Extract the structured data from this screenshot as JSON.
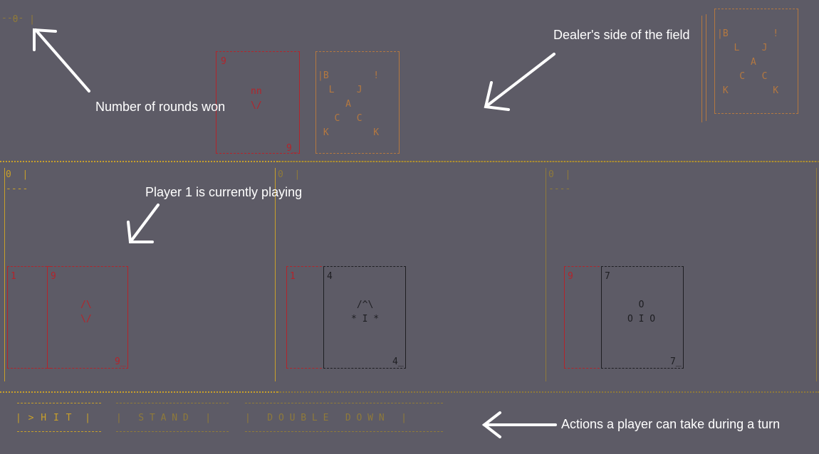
{
  "dealer": {
    "rounds_won": "0",
    "card_face_rank": "9",
    "card_face_pip": "nn\n\\/",
    "card_back_lines": "|B        !\n  L    J\n     A\n   C   C\n K        K",
    "deck_lines": "|B        !\n   L    J\n      A\n    C   C\n K        K"
  },
  "players": [
    {
      "rounds_won": "0",
      "card1_rank": "1",
      "card2_rank": "9",
      "card2_pip": "/\\\n\\/",
      "card2_corner": "9_",
      "active": true
    },
    {
      "rounds_won": "0",
      "card1_rank": "1",
      "card2_rank": "4",
      "card2_pip": " /^\\\n* I *",
      "card2_corner": "4_",
      "active": false
    },
    {
      "rounds_won": "0",
      "card1_rank": "9",
      "card2_rank": "7",
      "card2_pip": "  O\nO I O",
      "card2_corner": "7_",
      "active": false
    }
  ],
  "actions": {
    "hit": "| > H I T  |",
    "stand": "|   S T A N D   |",
    "double_down": "|   D O U B L E   D O W N   |"
  },
  "annotations": {
    "rounds": "Number of rounds won",
    "dealer_side": "Dealer's side of the field",
    "current_player": "Player 1 is currently playing",
    "actions": "Actions a player can take during a turn"
  },
  "colors": {
    "background": "#5d5b66",
    "frame": "#c9a02a",
    "red_card": "#b3242b",
    "card_back": "#b47840",
    "black_card": "#1e1e22"
  }
}
